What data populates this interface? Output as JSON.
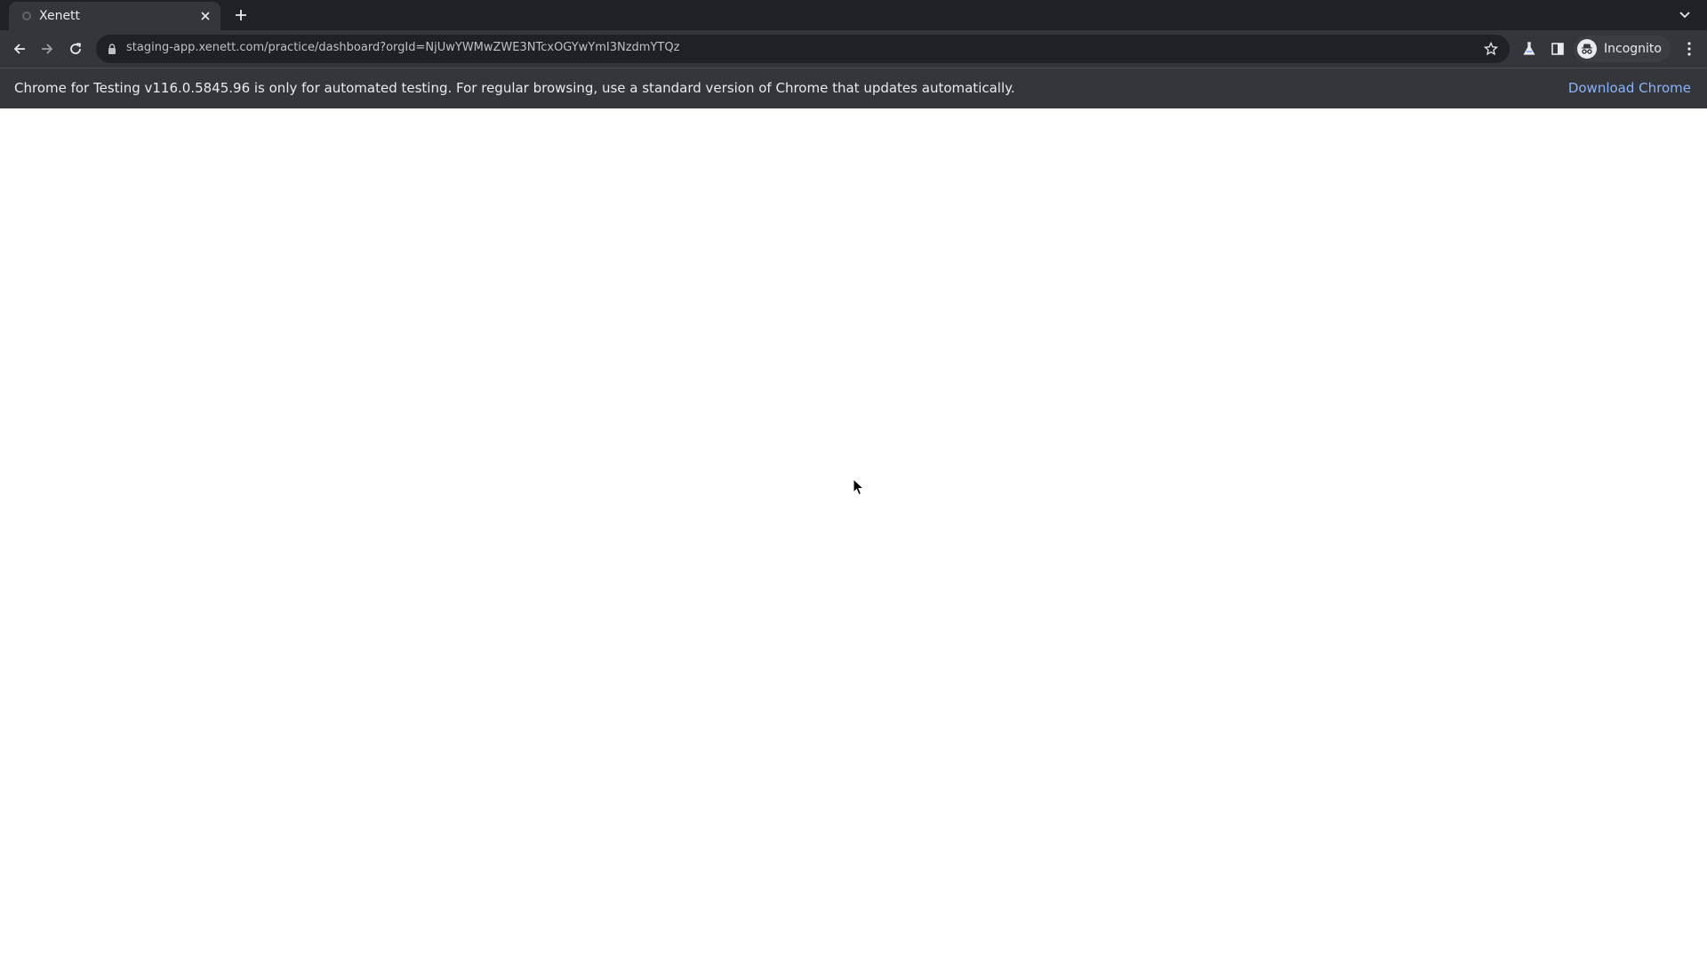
{
  "tab": {
    "title": "Xenett"
  },
  "omnibox": {
    "url": "staging-app.xenett.com/practice/dashboard?orgId=NjUwYWMwZWE3NTcxOGYwYmI3NzdmYTQz"
  },
  "profile": {
    "label": "Incognito"
  },
  "infobar": {
    "message": "Chrome for Testing v116.0.5845.96 is only for automated testing. For regular browsing, use a standard version of Chrome that updates automatically.",
    "link": "Download Chrome"
  },
  "colors": {
    "tabstrip": "#202124",
    "toolbar": "#35363a",
    "link": "#8ab4f8",
    "page": "#ffffff"
  },
  "icons": {
    "favicon": "loading-favicon-icon",
    "tab_close": "close-icon",
    "new_tab": "plus-icon",
    "tab_search": "chevron-down-icon",
    "back": "arrow-left-icon",
    "forward": "arrow-right-icon",
    "reload": "reload-icon",
    "lock": "lock-icon",
    "bookmark": "star-icon",
    "labs": "flask-icon",
    "side_panel": "side-panel-icon",
    "incognito": "incognito-icon",
    "menu": "kebab-menu-icon",
    "cursor": "mouse-pointer-icon"
  }
}
